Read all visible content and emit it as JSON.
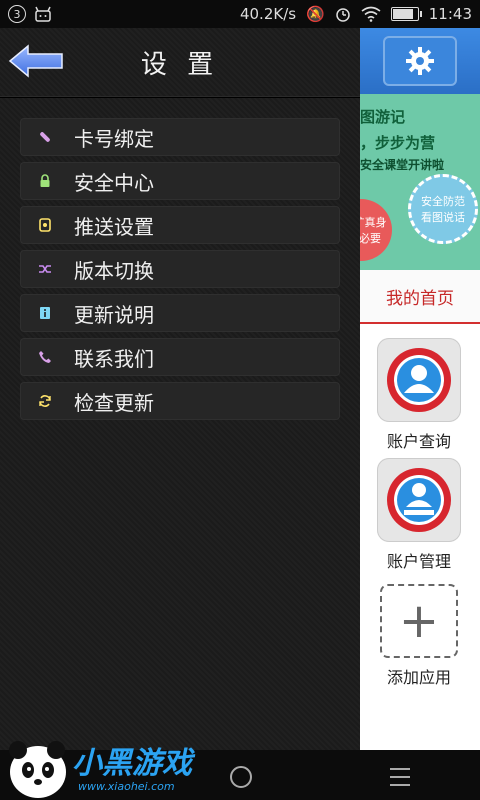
{
  "status_bar": {
    "notification_count": "3",
    "speed": "40.2K/s",
    "time": "11:43",
    "battery_level": 0.9
  },
  "drawer": {
    "title": "设 置",
    "items": [
      {
        "label": "卡号绑定",
        "icon": "link-icon",
        "color": "#d8a0e8"
      },
      {
        "label": "安全中心",
        "icon": "lock-icon",
        "color": "#9fe37a"
      },
      {
        "label": "推送设置",
        "icon": "push-icon",
        "color": "#ffe36b"
      },
      {
        "label": "版本切换",
        "icon": "shuffle-icon",
        "color": "#c98cf0"
      },
      {
        "label": "更新说明",
        "icon": "info-icon",
        "color": "#7fd8f5"
      },
      {
        "label": "联系我们",
        "icon": "phone-icon",
        "color": "#d8a0e8"
      },
      {
        "label": "检查更新",
        "icon": "refresh-icon",
        "color": "#ffe36b"
      }
    ]
  },
  "right_panel": {
    "banner": {
      "line1": "图游记",
      "line2": "，步步为营",
      "line3": "安全课堂开讲啦",
      "bubble_right": "安全防范\n看图说话",
      "bubble_left": "扩真身\n必要"
    },
    "tab_title": "我的首页",
    "apps": [
      {
        "label": "账户查询"
      },
      {
        "label": "账户管理"
      },
      {
        "label": "添加应用"
      }
    ]
  },
  "watermark": {
    "text": "小黑游戏",
    "url": "www.xiaohei.com"
  },
  "colors": {
    "accent_blue": "#2f7bd6",
    "tab_red": "#c62828"
  }
}
